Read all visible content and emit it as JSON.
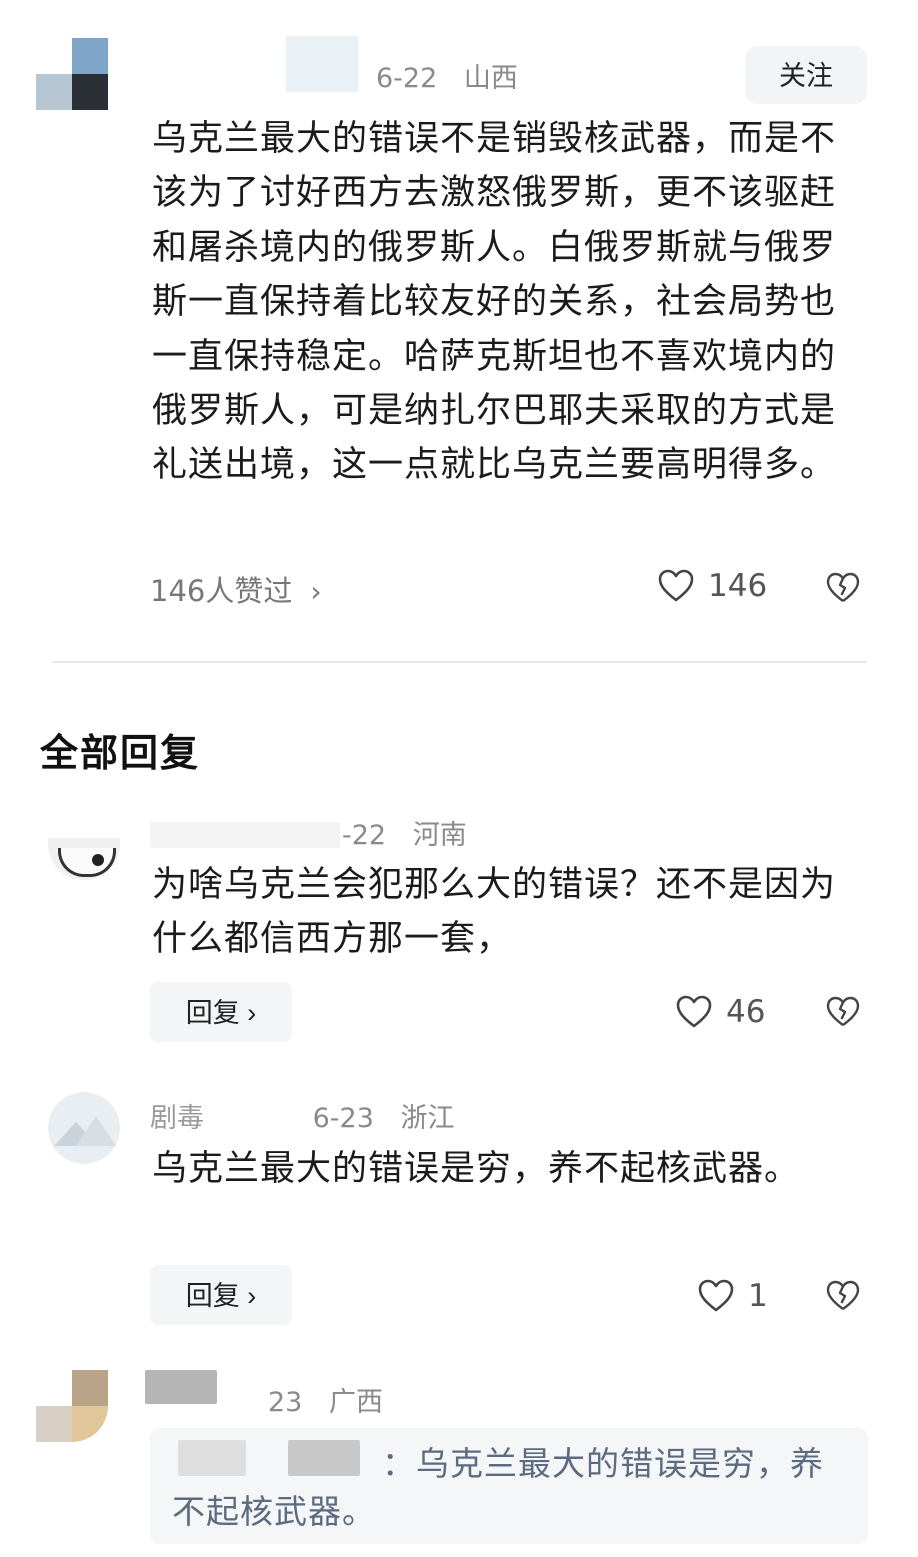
{
  "post": {
    "date": "6-22",
    "location": "山西",
    "follow_label": "关注",
    "text": "乌克兰最大的错误不是销毁核武器，而是不该为了讨好西方去激怒俄罗斯，更不该驱赶和屠杀境内的俄罗斯人。白俄罗斯就与俄罗斯一直保持着比较友好的关系，社会局势也一直保持稳定。哈萨克斯坦也不喜欢境内的俄罗斯人，可是纳扎尔巴耶夫采取的方式是礼送出境，这一点就比乌克兰要高明得多。",
    "liked_by": "146人赞过",
    "like_count": "146"
  },
  "section_title": "全部回复",
  "replies": [
    {
      "date": "-22",
      "location": "河南",
      "text": "为啥乌克兰会犯那么大的错误？还不是因为什么都信西方那一套，",
      "reply_label": "回复",
      "like_count": "46"
    },
    {
      "username": "剧毒",
      "date": "6-23",
      "location": "浙江",
      "text": "乌克兰最大的错误是穷，养不起核武器。",
      "reply_label": "回复",
      "like_count": "1"
    },
    {
      "date": "23",
      "location": "广西",
      "quote_prefix": "：",
      "quote_text": "乌克兰最大的错误是穷，养不起核武器。"
    }
  ],
  "icons": {
    "like": "heart-outline-icon",
    "dislike": "broken-heart-icon",
    "chevron": "chevron-right-icon"
  },
  "colors": {
    "meta": "#8a8a8a",
    "button_bg": "#f3f4f6",
    "quote_highlight": "#5c6b80"
  }
}
